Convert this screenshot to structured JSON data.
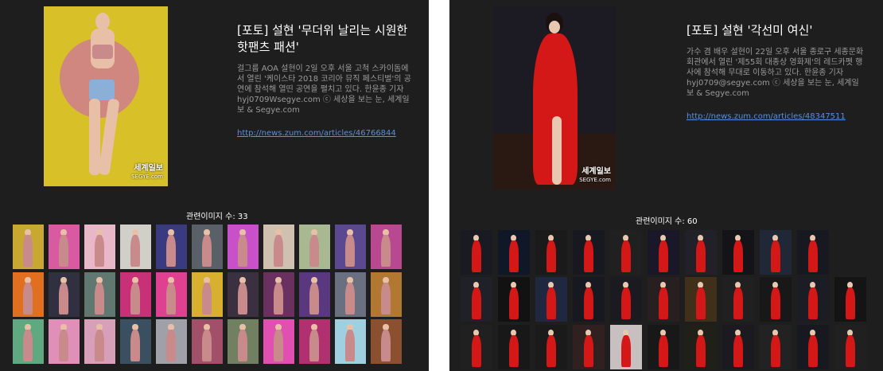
{
  "left": {
    "title": "[포토] 설현 '무더위 날리는 시원한 핫팬츠 패션'",
    "description": "걸그룹 AOA 설현이 2일 오후 서울 고척 스카이돔에서 열린 '케이스타 2018 코리아 뮤직 페스티벌'의 공연에 참석해 열띤 공연을 펼치고 있다. 한윤종 기자 hyj0709Wsegye.com ⓒ 세상을 보는 눈, 세계일보 & Segye.com",
    "link": "http://news.zum.com/articles/46766844",
    "related_count": "관련이미지 수: 33",
    "photo_credit": "세계일보",
    "photo_credit_sub": "SEGYE.com",
    "main_photo_bg": "#d8c028",
    "figure_skin": "#e8c0a8",
    "figure_outfit": "#c88a8a",
    "thumbs": [
      [
        "#c8a830",
        "#d85aa0",
        "#e8b8c8",
        "#d0d0c8",
        "#3a3a80",
        "#5a6068",
        "#c850c8",
        "#d0c0b0",
        "#a8b890",
        "#5a4890",
        "#b84890"
      ],
      [
        "#e07020",
        "#303040",
        "#607870",
        "#c83078",
        "#e04090",
        "#d8b030",
        "#3a3040",
        "#6a3060",
        "#5a3880",
        "#6a7080",
        "#b07830"
      ],
      [
        "#60a880",
        "#e090b8",
        "#d8a0b8",
        "#3a5060",
        "#a0a0a8",
        "#a05068",
        "#708060",
        "#e050b0",
        "#b03070",
        "#a0d0e0",
        "#8a5030"
      ]
    ]
  },
  "right": {
    "title": "[포토] 설현 '각선미 여신'",
    "description": "가수 겸 배우 설현이 22일 오후 서울 종로구 세종문화회관에서 열린 '제55회 대종상 영화제'의 레드카펫 행사에 참석해 무대로 이동하고 있다. 한윤종 기자 hyj0709@segye.com ⓒ 세상을 보는 눈, 세계일보 & Segye.com",
    "link": "http://news.zum.com/articles/48347511",
    "related_count": "관련이미지 수: 60",
    "photo_credit": "세계일보",
    "photo_credit_sub": "SEGYE.com",
    "main_photo_bg": "#1c1a22",
    "figure_skin": "#e8c8b0",
    "figure_outfit": "#d41818",
    "thumbs": [
      [
        "#1a1a22",
        "#101828",
        "#1a1a1a",
        "#181820",
        "#202020",
        "#1a1828",
        "#222028",
        "#141418",
        "#202838",
        "#181820"
      ],
      [
        "#202028",
        "#121212",
        "#202840",
        "#181820",
        "#1a1a20",
        "#282020",
        "#40301a",
        "#202020",
        "#181818",
        "#1c1c24",
        "#141414"
      ],
      [
        "#202020",
        "#181818",
        "#1a1a1a",
        "#302020",
        "#c8c0c0",
        "#181818",
        "#202018",
        "#1a1a20",
        "#222222",
        "#181820",
        "#202020"
      ]
    ]
  }
}
